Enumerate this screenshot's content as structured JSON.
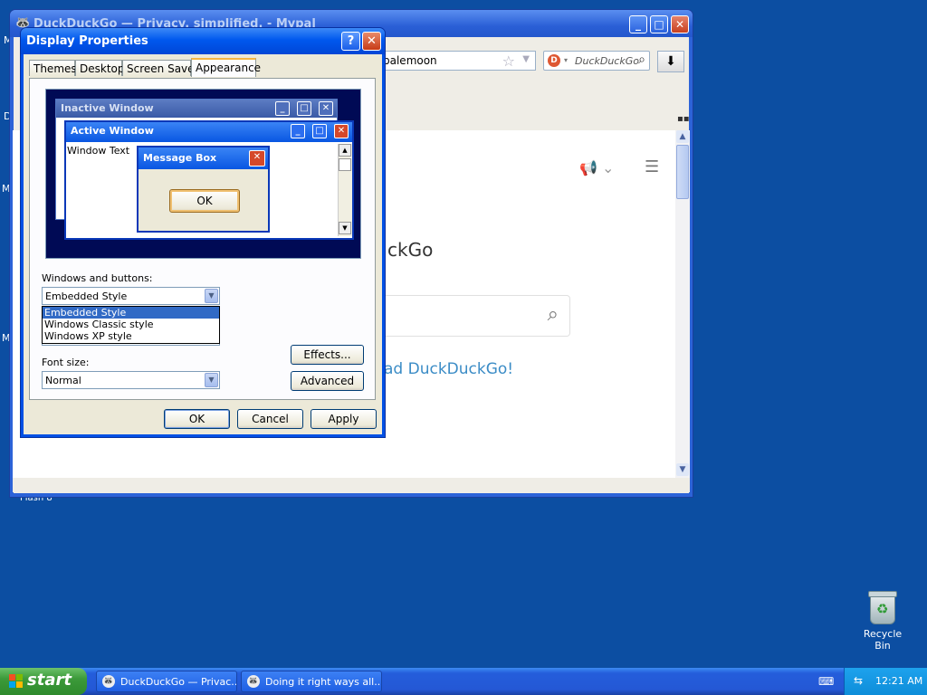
{
  "desktop": {
    "left_fragments": [
      "M",
      "D",
      "M",
      "M"
    ],
    "bottom_fragment": "Flash 8",
    "recycle_bin_label": "Recycle Bin"
  },
  "browser": {
    "title": "DuckDuckGo — Privacy, simplified. - Mypal",
    "address_text": "palemoon",
    "search_placeholder": "DuckDuckGo",
    "page": {
      "heading_fragment": "ckGo",
      "link_fragment": "ad DuckDuckGo!"
    }
  },
  "dialog": {
    "title": "Display Properties",
    "help_label": "?",
    "tabs": [
      "Themes",
      "Desktop",
      "Screen Saver",
      "Appearance"
    ],
    "selected_tab": "Appearance",
    "preview": {
      "inactive_title": "Inactive Window",
      "active_title": "Active Window",
      "window_text": "Window Text",
      "message_title": "Message Box",
      "ok_label": "OK"
    },
    "windows_and_buttons_label": "Windows and buttons:",
    "windows_and_buttons_value": "Embedded Style",
    "style_options": [
      "Embedded Style",
      "Windows Classic style",
      "Windows XP style"
    ],
    "font_size_label": "Font size:",
    "font_size_value": "Normal",
    "effects_label": "Effects...",
    "advanced_label": "Advanced",
    "ok_label": "OK",
    "cancel_label": "Cancel",
    "apply_label": "Apply"
  },
  "taskbar": {
    "start_label": "start",
    "tasks": [
      "DuckDuckGo — Privac...",
      "Doing it right ways all..."
    ],
    "clock": "12:21 AM"
  },
  "colors": {
    "desktop": "#0c4ea2",
    "dialog_title": "#0050e4",
    "dropdown_selection": "#316ac5",
    "link": "#3b8cc6"
  }
}
